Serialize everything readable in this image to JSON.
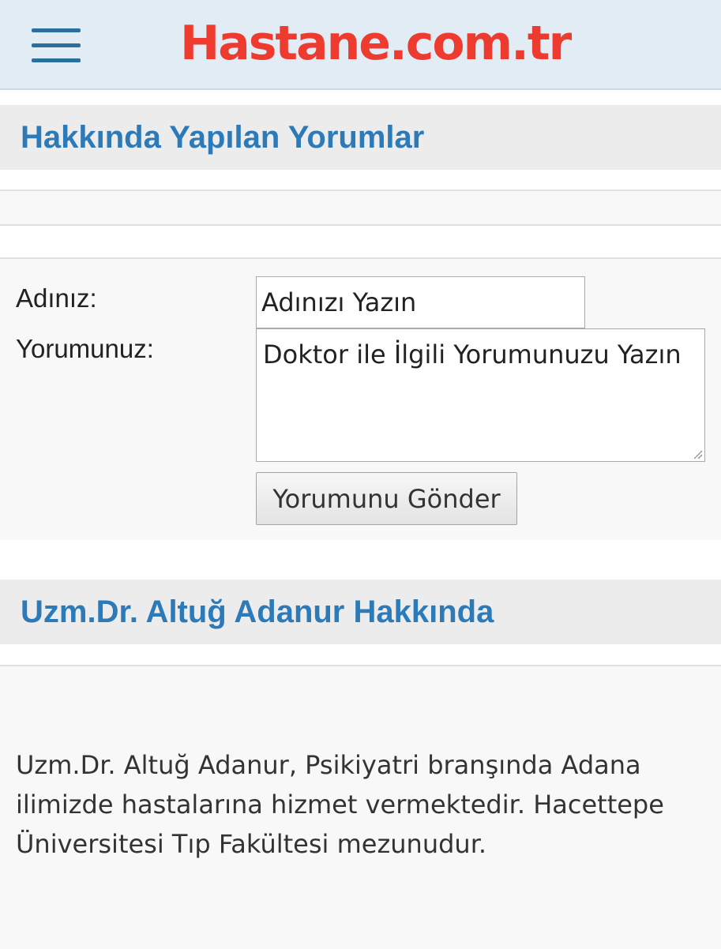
{
  "header": {
    "logo_text": "Hastane.com.tr",
    "logo_color": "#ee3b2f",
    "menu_icon": "hamburger-menu-icon"
  },
  "comments_section": {
    "title": "Hakkında Yapılan Yorumlar"
  },
  "comment_form": {
    "name_label": "Adınız:",
    "name_value": "Adınızı Yazın",
    "comment_label": "Yorumunuz:",
    "comment_value": "Doktor ile İlgili Yorumunuzu Yazın",
    "submit_label": "Yorumunu Gönder"
  },
  "about_section": {
    "title": "Uzm.Dr. Altuğ Adanur Hakkında",
    "text": "Uzm.Dr. Altuğ Adanur, Psikiyatri branşında Adana ilimizde hastalarına hizmet vermektedir. Hacettepe Üniversitesi Tıp Fakültesi mezunudur."
  },
  "colors": {
    "header_bg": "#e1ecf5",
    "heading_text": "#2c7ab8",
    "menu_icon": "#2b6f9e"
  }
}
